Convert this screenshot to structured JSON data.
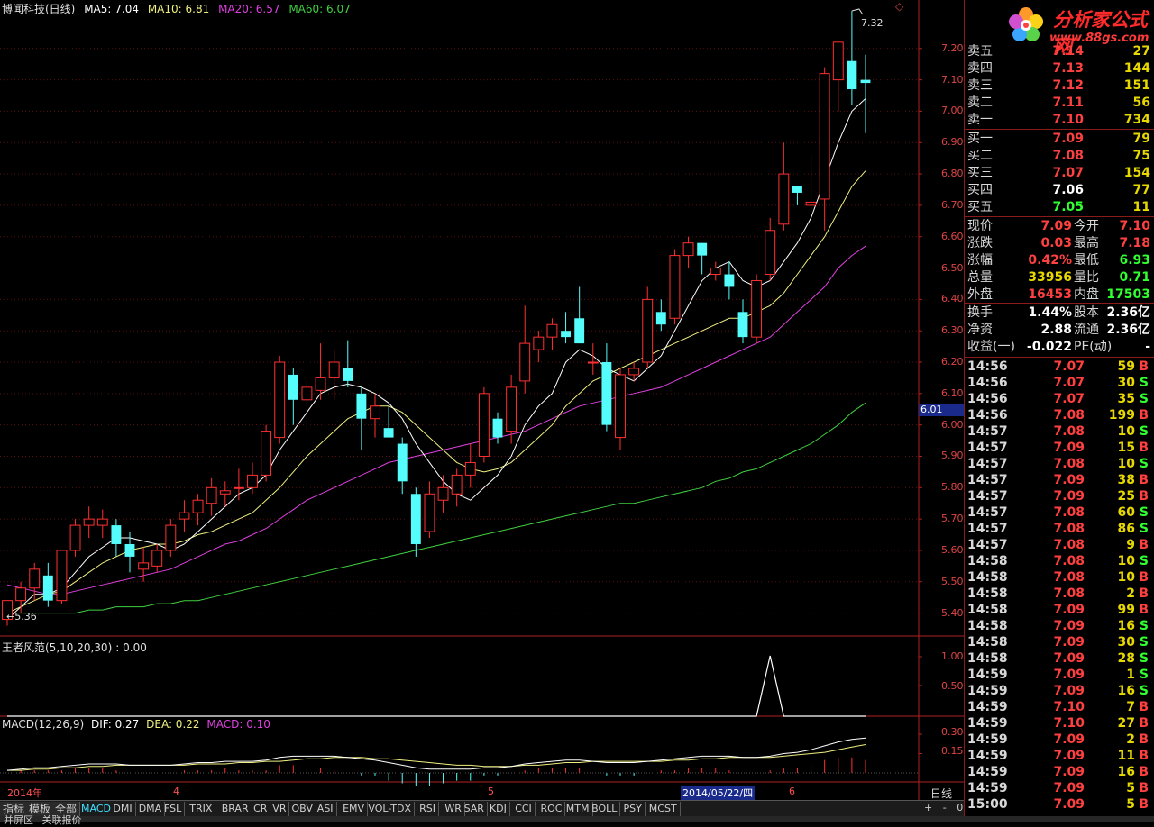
{
  "header": {
    "title": "博闻科技(日线)",
    "ma5": "MA5: 7.04",
    "ma10": "MA10: 6.81",
    "ma20": "MA20: 6.57",
    "ma60": "MA60: 6.07"
  },
  "chart_annot": {
    "high_label": "7.32",
    "low_label": "←5.36",
    "cursor_price": "6.01",
    "diamond": "◇"
  },
  "price_axis": [
    "7.20",
    "7.10",
    "7.00",
    "6.90",
    "6.80",
    "6.70",
    "6.60",
    "6.50",
    "6.40",
    "6.30",
    "6.20",
    "6.10",
    "6.00",
    "5.90",
    "5.80",
    "5.70",
    "5.60",
    "5.50",
    "5.40"
  ],
  "indicator1": {
    "title": "王者风范(5,10,20,30)",
    "value": ": 0.00",
    "axis": [
      "1.00",
      "0.50"
    ]
  },
  "indicator2": {
    "title": "MACD(12,26,9)",
    "dif": "DIF: 0.27",
    "dea": "DEA: 0.22",
    "macd": "MACD: 0.10",
    "axis": [
      "0.30",
      "0.15"
    ]
  },
  "x_labels": {
    "year": "2014年",
    "m4": "4",
    "m5": "5",
    "m6": "6",
    "cursor_date": "2014/05/22/四",
    "period": "日线"
  },
  "colors": {
    "up": "#ff3030",
    "down": "#54fcfc",
    "ma5": "#ffffff",
    "ma10": "#f0f080",
    "ma20": "#e040e0",
    "ma60": "#40d040",
    "axis": "#b02020"
  },
  "chart_data": {
    "type": "candlestick",
    "title": "博闻科技(日线)",
    "ylim": [
      5.35,
      7.32
    ],
    "candles": [
      [
        5.38,
        5.44,
        5.36,
        5.44
      ],
      [
        5.44,
        5.5,
        5.4,
        5.48
      ],
      [
        5.48,
        5.56,
        5.44,
        5.54
      ],
      [
        5.52,
        5.56,
        5.42,
        5.44
      ],
      [
        5.44,
        5.56,
        5.43,
        5.6
      ],
      [
        5.6,
        5.7,
        5.58,
        5.68
      ],
      [
        5.68,
        5.74,
        5.64,
        5.7
      ],
      [
        5.68,
        5.73,
        5.64,
        5.7
      ],
      [
        5.68,
        5.7,
        5.58,
        5.62
      ],
      [
        5.62,
        5.66,
        5.53,
        5.58
      ],
      [
        5.54,
        5.61,
        5.5,
        5.56
      ],
      [
        5.55,
        5.62,
        5.53,
        5.6
      ],
      [
        5.6,
        5.7,
        5.58,
        5.68
      ],
      [
        5.7,
        5.76,
        5.66,
        5.72
      ],
      [
        5.72,
        5.78,
        5.68,
        5.76
      ],
      [
        5.75,
        5.83,
        5.71,
        5.8
      ],
      [
        5.78,
        5.82,
        5.74,
        5.79
      ],
      [
        5.8,
        5.86,
        5.76,
        5.8
      ],
      [
        5.8,
        5.88,
        5.78,
        5.84
      ],
      [
        5.84,
        6.0,
        5.82,
        5.98
      ],
      [
        5.96,
        6.22,
        5.94,
        6.2
      ],
      [
        6.16,
        6.18,
        6.0,
        6.08
      ],
      [
        6.08,
        6.14,
        5.98,
        6.12
      ],
      [
        6.11,
        6.26,
        6.08,
        6.15
      ],
      [
        6.15,
        6.24,
        6.08,
        6.2
      ],
      [
        6.18,
        6.27,
        6.12,
        6.14
      ],
      [
        6.1,
        6.12,
        5.92,
        6.02
      ],
      [
        6.02,
        6.1,
        5.96,
        6.06
      ],
      [
        5.99,
        6.06,
        5.96,
        5.96
      ],
      [
        5.94,
        5.96,
        5.78,
        5.82
      ],
      [
        5.78,
        5.8,
        5.58,
        5.62
      ],
      [
        5.66,
        5.82,
        5.64,
        5.78
      ],
      [
        5.76,
        5.84,
        5.72,
        5.8
      ],
      [
        5.78,
        5.86,
        5.74,
        5.84
      ],
      [
        5.84,
        5.94,
        5.8,
        5.88
      ],
      [
        5.9,
        6.12,
        5.88,
        6.1
      ],
      [
        6.02,
        6.04,
        5.94,
        5.96
      ],
      [
        5.98,
        6.16,
        5.94,
        6.12
      ],
      [
        6.14,
        6.38,
        6.1,
        6.26
      ],
      [
        6.24,
        6.3,
        6.2,
        6.28
      ],
      [
        6.28,
        6.34,
        6.24,
        6.32
      ],
      [
        6.3,
        6.36,
        6.26,
        6.28
      ],
      [
        6.34,
        6.44,
        6.26,
        6.26
      ],
      [
        6.2,
        6.26,
        6.16,
        6.2
      ],
      [
        6.2,
        6.26,
        5.98,
        6.0
      ],
      [
        5.96,
        6.18,
        5.92,
        6.16
      ],
      [
        6.16,
        6.2,
        6.14,
        6.18
      ],
      [
        6.2,
        6.44,
        6.18,
        6.4
      ],
      [
        6.36,
        6.4,
        6.3,
        6.32
      ],
      [
        6.34,
        6.56,
        6.32,
        6.54
      ],
      [
        6.54,
        6.6,
        6.5,
        6.58
      ],
      [
        6.58,
        6.58,
        6.48,
        6.54
      ],
      [
        6.48,
        6.52,
        6.46,
        6.5
      ],
      [
        6.48,
        6.52,
        6.4,
        6.44
      ],
      [
        6.36,
        6.4,
        6.26,
        6.28
      ],
      [
        6.28,
        6.48,
        6.26,
        6.46
      ],
      [
        6.48,
        6.66,
        6.46,
        6.62
      ],
      [
        6.64,
        6.9,
        6.62,
        6.8
      ],
      [
        6.76,
        6.76,
        6.7,
        6.74
      ],
      [
        6.7,
        6.86,
        6.68,
        6.71
      ],
      [
        6.72,
        7.14,
        6.62,
        7.12
      ],
      [
        7.1,
        7.22,
        7.0,
        7.22
      ],
      [
        7.16,
        7.32,
        7.02,
        7.07
      ],
      [
        7.1,
        7.18,
        6.93,
        7.09
      ]
    ],
    "ma5": [
      5.38,
      5.42,
      5.46,
      5.46,
      5.48,
      5.53,
      5.58,
      5.61,
      5.64,
      5.64,
      5.63,
      5.62,
      5.6,
      5.62,
      5.66,
      5.7,
      5.74,
      5.78,
      5.8,
      5.84,
      5.92,
      5.98,
      6.04,
      6.1,
      6.12,
      6.13,
      6.12,
      6.1,
      6.07,
      6.02,
      5.94,
      5.88,
      5.82,
      5.78,
      5.76,
      5.8,
      5.84,
      5.9,
      6.0,
      6.06,
      6.1,
      6.2,
      6.24,
      6.22,
      6.18,
      6.16,
      6.14,
      6.18,
      6.22,
      6.3,
      6.38,
      6.46,
      6.5,
      6.52,
      6.46,
      6.44,
      6.46,
      6.52,
      6.58,
      6.66,
      6.78,
      6.9,
      7.0,
      7.04
    ],
    "ma10": [
      5.4,
      5.42,
      5.44,
      5.46,
      5.47,
      5.5,
      5.53,
      5.56,
      5.58,
      5.6,
      5.61,
      5.62,
      5.62,
      5.63,
      5.65,
      5.66,
      5.68,
      5.7,
      5.72,
      5.76,
      5.8,
      5.85,
      5.9,
      5.94,
      5.98,
      6.02,
      6.04,
      6.06,
      6.06,
      6.04,
      6.0,
      5.96,
      5.92,
      5.88,
      5.86,
      5.85,
      5.86,
      5.88,
      5.92,
      5.96,
      6.0,
      6.06,
      6.1,
      6.14,
      6.16,
      6.18,
      6.2,
      6.22,
      6.24,
      6.26,
      6.28,
      6.3,
      6.32,
      6.34,
      6.34,
      6.36,
      6.38,
      6.42,
      6.48,
      6.54,
      6.6,
      6.68,
      6.76,
      6.81
    ],
    "ma20": [
      5.49,
      5.48,
      5.47,
      5.46,
      5.46,
      5.47,
      5.48,
      5.49,
      5.5,
      5.51,
      5.52,
      5.53,
      5.54,
      5.56,
      5.58,
      5.6,
      5.62,
      5.63,
      5.65,
      5.67,
      5.7,
      5.73,
      5.76,
      5.78,
      5.8,
      5.82,
      5.84,
      5.86,
      5.88,
      5.89,
      5.9,
      5.91,
      5.92,
      5.93,
      5.94,
      5.95,
      5.96,
      5.97,
      5.98,
      6.0,
      6.02,
      6.04,
      6.06,
      6.07,
      6.08,
      6.09,
      6.1,
      6.11,
      6.12,
      6.14,
      6.16,
      6.18,
      6.2,
      6.22,
      6.24,
      6.26,
      6.28,
      6.32,
      6.36,
      6.4,
      6.44,
      6.5,
      6.54,
      6.57
    ],
    "ma60": [
      5.4,
      5.4,
      5.4,
      5.4,
      5.4,
      5.4,
      5.41,
      5.41,
      5.42,
      5.42,
      5.42,
      5.43,
      5.43,
      5.44,
      5.44,
      5.45,
      5.46,
      5.47,
      5.48,
      5.49,
      5.5,
      5.51,
      5.52,
      5.53,
      5.54,
      5.55,
      5.56,
      5.57,
      5.58,
      5.59,
      5.6,
      5.61,
      5.62,
      5.63,
      5.64,
      5.65,
      5.66,
      5.67,
      5.68,
      5.69,
      5.7,
      5.71,
      5.72,
      5.73,
      5.74,
      5.75,
      5.75,
      5.76,
      5.77,
      5.78,
      5.79,
      5.8,
      5.82,
      5.83,
      5.85,
      5.86,
      5.88,
      5.9,
      5.92,
      5.94,
      5.97,
      6.0,
      6.04,
      6.07
    ],
    "signal": [
      0,
      0,
      0,
      0,
      0,
      0,
      0,
      0,
      0,
      0,
      0,
      0,
      0,
      0,
      0,
      0,
      0,
      0,
      0,
      0,
      0,
      0,
      0,
      0,
      0,
      0,
      0,
      0,
      0,
      0,
      0,
      0,
      0,
      0,
      0,
      0,
      0,
      0,
      0,
      0,
      0,
      0,
      0,
      0,
      0,
      0,
      0,
      0,
      0,
      0,
      0,
      0,
      0,
      0,
      0,
      0,
      1,
      0,
      0,
      0,
      0,
      0,
      0,
      0
    ],
    "dif": [
      0.02,
      0.03,
      0.04,
      0.04,
      0.05,
      0.06,
      0.07,
      0.07,
      0.07,
      0.06,
      0.06,
      0.06,
      0.06,
      0.07,
      0.08,
      0.08,
      0.09,
      0.09,
      0.09,
      0.1,
      0.12,
      0.13,
      0.13,
      0.13,
      0.13,
      0.12,
      0.11,
      0.1,
      0.08,
      0.06,
      0.04,
      0.03,
      0.03,
      0.03,
      0.03,
      0.04,
      0.04,
      0.05,
      0.07,
      0.08,
      0.09,
      0.1,
      0.1,
      0.09,
      0.08,
      0.08,
      0.08,
      0.09,
      0.1,
      0.11,
      0.12,
      0.13,
      0.13,
      0.13,
      0.12,
      0.12,
      0.13,
      0.15,
      0.16,
      0.18,
      0.21,
      0.24,
      0.26,
      0.27
    ],
    "dea": [
      0.02,
      0.02,
      0.03,
      0.03,
      0.04,
      0.04,
      0.05,
      0.05,
      0.06,
      0.06,
      0.06,
      0.06,
      0.06,
      0.06,
      0.07,
      0.07,
      0.07,
      0.08,
      0.08,
      0.09,
      0.09,
      0.1,
      0.11,
      0.11,
      0.12,
      0.12,
      0.12,
      0.11,
      0.11,
      0.1,
      0.09,
      0.08,
      0.07,
      0.06,
      0.06,
      0.05,
      0.05,
      0.05,
      0.06,
      0.06,
      0.07,
      0.08,
      0.08,
      0.09,
      0.09,
      0.09,
      0.09,
      0.09,
      0.09,
      0.1,
      0.1,
      0.11,
      0.11,
      0.12,
      0.12,
      0.12,
      0.12,
      0.13,
      0.14,
      0.15,
      0.16,
      0.18,
      0.2,
      0.22
    ]
  },
  "panel": {
    "logo_text": "分析家公式网",
    "logo_url": "www.88gs.com",
    "asks": [
      {
        "label": "卖五",
        "price": "7.14",
        "vol": "27"
      },
      {
        "label": "卖四",
        "price": "7.13",
        "vol": "144"
      },
      {
        "label": "卖三",
        "price": "7.12",
        "vol": "151"
      },
      {
        "label": "卖二",
        "price": "7.11",
        "vol": "56"
      },
      {
        "label": "卖一",
        "price": "7.10",
        "vol": "734"
      }
    ],
    "bids": [
      {
        "label": "买一",
        "price": "7.09",
        "vol": "79"
      },
      {
        "label": "买二",
        "price": "7.08",
        "vol": "75"
      },
      {
        "label": "买三",
        "price": "7.07",
        "vol": "154"
      },
      {
        "label": "买四",
        "price": "7.06",
        "vol": "77"
      },
      {
        "label": "买五",
        "price": "7.05",
        "vol": "11"
      }
    ],
    "quote": [
      {
        "l1": "现价",
        "v1": "7.09",
        "l2": "今开",
        "v2": "7.10"
      },
      {
        "l1": "涨跌",
        "v1": "0.03",
        "l2": "最高",
        "v2": "7.18"
      },
      {
        "l1": "涨幅",
        "v1": "0.42%",
        "l2": "最低",
        "v2": "6.93"
      },
      {
        "l1": "总量",
        "v1": "33956",
        "l2": "量比",
        "v2": "0.71"
      },
      {
        "l1": "外盘",
        "v1": "16453",
        "l2": "内盘",
        "v2": "17503"
      }
    ],
    "stats": [
      {
        "l1": "换手",
        "v1": "1.44%",
        "l2": "股本",
        "v2": "2.36亿"
      },
      {
        "l1": "净资",
        "v1": "2.88",
        "l2": "流通",
        "v2": "2.36亿"
      },
      {
        "l1": "收益(一)",
        "v1": "-0.022",
        "l2": "PE(动)",
        "v2": "-"
      }
    ],
    "ticks": [
      [
        "14:56",
        "7.07",
        "59",
        "B"
      ],
      [
        "14:56",
        "7.07",
        "30",
        "S"
      ],
      [
        "14:56",
        "7.07",
        "35",
        "S"
      ],
      [
        "14:56",
        "7.08",
        "199",
        "B"
      ],
      [
        "14:57",
        "7.08",
        "10",
        "S"
      ],
      [
        "14:57",
        "7.09",
        "15",
        "B"
      ],
      [
        "14:57",
        "7.08",
        "10",
        "S"
      ],
      [
        "14:57",
        "7.09",
        "38",
        "B"
      ],
      [
        "14:57",
        "7.09",
        "25",
        "B"
      ],
      [
        "14:57",
        "7.08",
        "60",
        "S"
      ],
      [
        "14:57",
        "7.08",
        "86",
        "S"
      ],
      [
        "14:57",
        "7.08",
        "9",
        "B"
      ],
      [
        "14:58",
        "7.08",
        "10",
        "S"
      ],
      [
        "14:58",
        "7.08",
        "10",
        "B"
      ],
      [
        "14:58",
        "7.08",
        "2",
        "B"
      ],
      [
        "14:58",
        "7.09",
        "99",
        "B"
      ],
      [
        "14:58",
        "7.09",
        "16",
        "S"
      ],
      [
        "14:58",
        "7.09",
        "30",
        "S"
      ],
      [
        "14:58",
        "7.09",
        "28",
        "S"
      ],
      [
        "14:59",
        "7.09",
        "1",
        "S"
      ],
      [
        "14:59",
        "7.09",
        "16",
        "S"
      ],
      [
        "14:59",
        "7.10",
        "7",
        "B"
      ],
      [
        "14:59",
        "7.10",
        "27",
        "B"
      ],
      [
        "14:59",
        "7.09",
        "2",
        "B"
      ],
      [
        "14:59",
        "7.09",
        "11",
        "B"
      ],
      [
        "14:59",
        "7.09",
        "16",
        "B"
      ],
      [
        "14:59",
        "7.09",
        "5",
        "B"
      ],
      [
        "15:00",
        "7.09",
        "5",
        "B"
      ]
    ]
  },
  "tabs": [
    "指标",
    "模板",
    "全部",
    "MACD",
    "DMI",
    "DMA",
    "FSL",
    "TRIX",
    "BRAR",
    "CR",
    "VR",
    "OBV",
    "ASI",
    "EMV",
    "VOL-TDX",
    "RSI",
    "WR",
    "SAR",
    "KDJ",
    "CCI",
    "ROC",
    "MTM",
    "BOLL",
    "PSY",
    "MCST"
  ],
  "scroll": {
    "plus": "+",
    "minus": "-",
    "zero": "0"
  },
  "status": {
    "left": "并屏区",
    "right": "关联报价"
  }
}
